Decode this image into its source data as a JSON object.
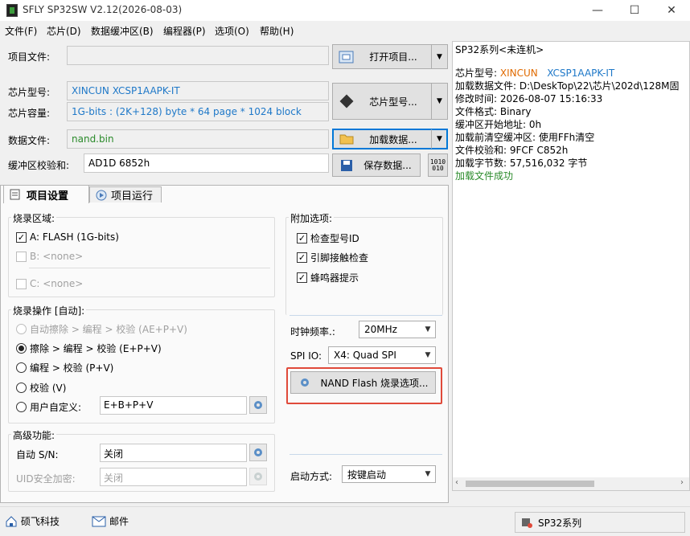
{
  "window": {
    "title": "SFLY SP32SW V2.12(2026-08-03)",
    "min": "—",
    "max": "☐",
    "close": "✕"
  },
  "menu": [
    "文件(F)",
    "芯片(D)",
    "数据缓冲区(B)",
    "编程器(P)",
    "选项(O)",
    "帮助(H)"
  ],
  "form": {
    "project_label": "项目文件:",
    "project_value": "",
    "open_project": "打开项目...",
    "chip_model_label": "芯片型号:",
    "chip_model_value": "XINCUN XCSP1AAPK-IT",
    "chip_capacity_label": "芯片容量:",
    "chip_capacity_value": "1G-bits : (2K+128) byte * 64 page * 1024 block",
    "chip_model_btn": "芯片型号...",
    "data_file_label": "数据文件:",
    "data_file_value": "nand.bin",
    "load_data": "加载数据...",
    "checksum_label": "缓冲区校验和:",
    "checksum_value": "AD1D 6852h",
    "save_data": "保存数据..."
  },
  "tabs": [
    "项目设置",
    "项目运行"
  ],
  "burn_area": {
    "title": "烧录区域:",
    "a": "A: FLASH (1G-bits)",
    "b": "B: <none>",
    "c": "C: <none>"
  },
  "burn_ops": {
    "title": "烧录操作 [自动]:",
    "opt1": "自动擦除 > 编程 > 校验 (AE+P+V)",
    "opt2": "擦除 > 编程 > 校验 (E+P+V)",
    "opt3": "编程 > 校验 (P+V)",
    "opt4": "校验 (V)",
    "opt5": "用户自定义:",
    "custom_value": "E+B+P+V"
  },
  "advanced": {
    "title": "高级功能:",
    "auto_sn": "自动 S/N:",
    "auto_sn_value": "关闭",
    "uid_label": "UID安全加密:",
    "uid_value": "关闭"
  },
  "extra": {
    "title": "附加选项:",
    "check_id": "检查型号ID",
    "pin_check": "引脚接触检查",
    "buzzer": "蜂鸣器提示",
    "clock_label": "时钟频率.:",
    "clock_value": "20MHz",
    "spi_label": "SPI IO:",
    "spi_value": "X4: Quad SPI",
    "nand_btn": "NAND Flash 烧录选项...",
    "start_label": "启动方式:",
    "start_value": "按键启动"
  },
  "log": {
    "header": "SP32系列<未连机>",
    "chip_label": "芯片型号: ",
    "chip_brand": "XINCUN",
    "chip_part": "XCSP1AAPK-IT",
    "lines": [
      "加载数据文件: D:\\DeskTop\\22\\芯片\\202d\\128M固",
      "修改时间: 2026-08-07 15:16:33",
      "文件格式: Binary",
      "缓冲区开始地址: 0h",
      "加载前清空缓冲区:  使用FFh清空",
      "文件校验和: 9FCF C852h",
      "加载字节数: 57,516,032 字节"
    ],
    "success": "加载文件成功"
  },
  "status": {
    "company": "硕飞科技",
    "mail": "邮件",
    "series": "SP32系列"
  },
  "colors": {
    "accent": "#1e78c8",
    "green": "#2a8a2a",
    "brand_orange": "#e06a00",
    "highlight": "#e04a3a"
  }
}
